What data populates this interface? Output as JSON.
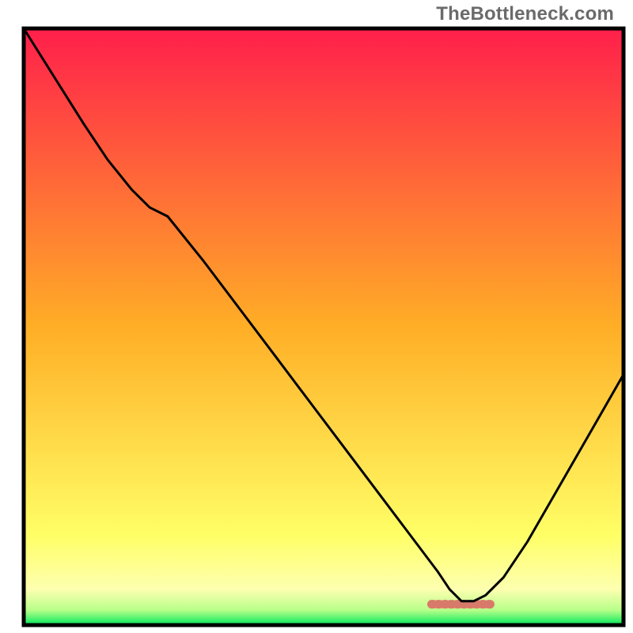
{
  "watermark": "TheBottleneck.com",
  "chart_data": {
    "type": "line",
    "title": "",
    "xlabel": "",
    "ylabel": "",
    "xlim": [
      0,
      100
    ],
    "ylim": [
      0,
      100
    ],
    "axes_visible": false,
    "grid": false,
    "background_gradient": {
      "type": "linear-vertical",
      "stops": [
        {
          "offset": 0.0,
          "color": "#ff1f4b"
        },
        {
          "offset": 0.5,
          "color": "#ffae26"
        },
        {
          "offset": 0.85,
          "color": "#ffff66"
        },
        {
          "offset": 0.94,
          "color": "#fdffb0"
        },
        {
          "offset": 0.975,
          "color": "#b7ff8a"
        },
        {
          "offset": 1.0,
          "color": "#00e85b"
        }
      ]
    },
    "curve": {
      "description": "bottleneck-style valley curve, minimum (optimal) near x ≈ 73",
      "x": [
        0,
        5,
        10,
        14,
        18,
        21,
        24,
        30,
        36,
        42,
        48,
        54,
        60,
        66,
        69,
        71,
        73,
        75,
        77,
        80,
        84,
        88,
        92,
        96,
        100
      ],
      "y": [
        100,
        92,
        84,
        78,
        73,
        70,
        68.5,
        61,
        53,
        45,
        37,
        29,
        21,
        13,
        9,
        6,
        4,
        4,
        5,
        8,
        14,
        21,
        28,
        35,
        42
      ]
    },
    "valley_marker": {
      "x_range": [
        68,
        78
      ],
      "y": 3.5,
      "color": "#d87a6a"
    },
    "frame": {
      "color": "#000000",
      "width": 5
    },
    "colors": {
      "curve": "#000000",
      "marker": "#d87a6a"
    }
  }
}
